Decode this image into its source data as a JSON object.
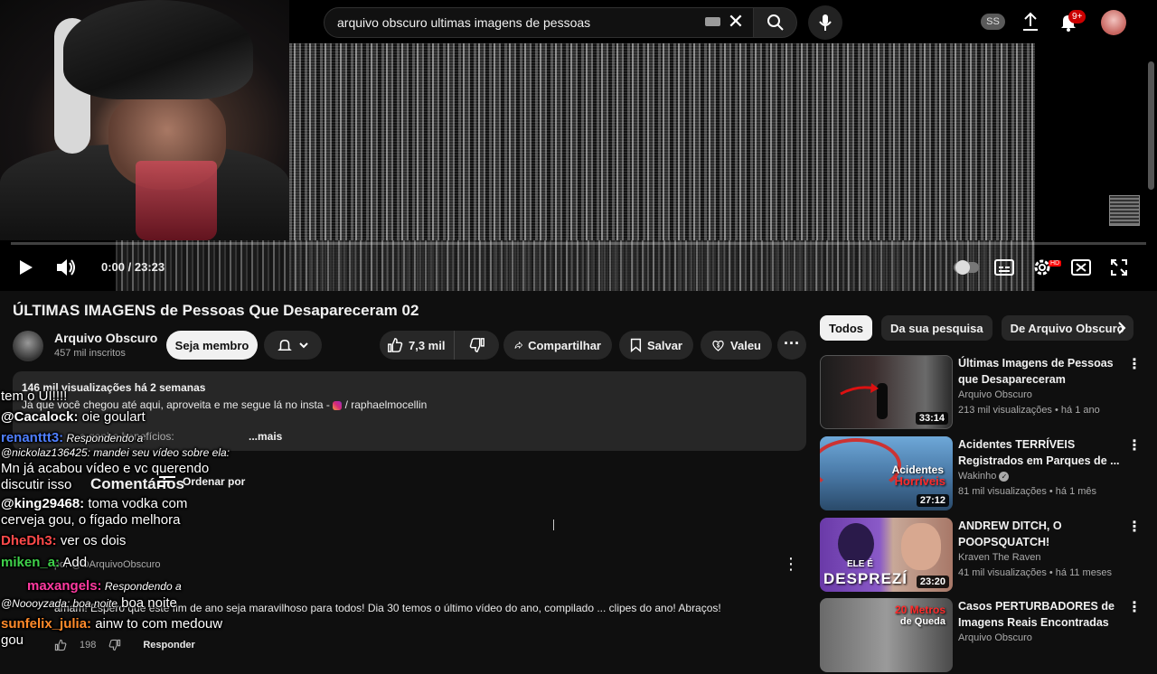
{
  "search": {
    "query": "arquivo obscuro ultimas imagens de pessoas"
  },
  "header": {
    "account_badge": "SS",
    "notifications_count": "9+"
  },
  "player": {
    "time": "0:00 / 23:23",
    "progress_fraction": 0.0
  },
  "video": {
    "title": "ÚLTIMAS IMAGENS de Pessoas Que Desapareceram 02",
    "channel": "Arquivo Obscuro",
    "subscribers": "457 mil inscritos",
    "join_label": "Seja membro",
    "likes": "7,3 mil",
    "share_label": "Compartilhar",
    "save_label": "Salvar",
    "thanks_label": "Valeu"
  },
  "description": {
    "stats": "146 mil visualizações  há 2 semanas",
    "line1": "Já que você chegou até aqui, aproveita e me segue lá no insta - ",
    "insta": "/ raphaelmocellin",
    "line2": "...e ganhe benefícios:",
    "more": "...mais"
  },
  "comments": {
    "title": "Comentários",
    "sort_label": "Ordenar por",
    "pinned_by": "por @OArquivoObscuro",
    "pinned_text": "amam! Espero que este fim de ano seja maravilhoso para todos! Dia 30 temos o último vídeo do ano, compilado ... clipes do ano! Abraços!",
    "likes": "198",
    "reply_label": "Responder"
  },
  "chat": {
    "l0": "tem o UI!!!!",
    "l1_user": "@Cacalock:",
    "l1_msg": " oie goulart",
    "l2_user": "renanttt3:",
    "l2_msg": " Respondendo a",
    "l3": "@nickolaz136425: mandei seu vídeo sobre ela:",
    "l4": "Mn já acabou vídeo e vc querendo",
    "l5": "discutir isso",
    "l6_user": "@king29468:",
    "l6_msg": " toma vodka com",
    "l7": "cerveja gou, o fígado melhora",
    "l8_user": "DheDh3:",
    "l8_msg": " ver os dois",
    "l9_user": "miken_a:",
    "l9_msg": " Add",
    "l10_user": "maxangels:",
    "l10_msg": " Respondendo a",
    "l11": "@Noooyzada: boa noite",
    "l11b": " boa noite",
    "l12_user": "sunfelix_julia:",
    "l12_msg": " ainw to com medouw",
    "l13": "gou"
  },
  "sidebar": {
    "chips": [
      "Todos",
      "Da sua pesquisa",
      "De Arquivo Obscuro"
    ],
    "recs": [
      {
        "title": "Últimas Imagens de Pessoas que Desapareceram",
        "channel": "Arquivo Obscuro",
        "meta": "213 mil visualizações • há 1 ano",
        "duration": "33:14",
        "thumb_text": ""
      },
      {
        "title": "Acidentes TERRÍVEIS Registrados em Parques de ...",
        "channel": "Wakinho",
        "meta": "81 mil visualizações • há 1 mês",
        "duration": "27:12",
        "thumb_text": "Acidentes",
        "thumb_text2": "Horríveis"
      },
      {
        "title": "ANDREW DITCH, O POOPSQUATCH!",
        "channel": "Kraven The Raven",
        "meta": "41 mil visualizações • há 11 meses",
        "duration": "23:20",
        "thumb_text": "ELE É",
        "thumb_text2": "DESPREZÍ"
      },
      {
        "title": "Casos PERTURBADORES de Imagens Reais Encontradas",
        "channel": "Arquivo Obscuro",
        "meta": "",
        "duration": "",
        "thumb_text": "20 Metros",
        "thumb_text2": "de Queda"
      }
    ]
  },
  "colors": {
    "accent": "#ff0000",
    "background": "#0f0f0f",
    "pill": "#272727"
  },
  "icons": [
    "search-icon",
    "mic-icon",
    "upload-icon",
    "bell-icon",
    "play-icon",
    "volume-icon",
    "settings-icon",
    "subtitles-icon",
    "miniplayer-icon",
    "fullscreen-icon",
    "like-icon",
    "dislike-icon",
    "share-icon",
    "save-icon",
    "thanks-icon",
    "sort-icon"
  ]
}
